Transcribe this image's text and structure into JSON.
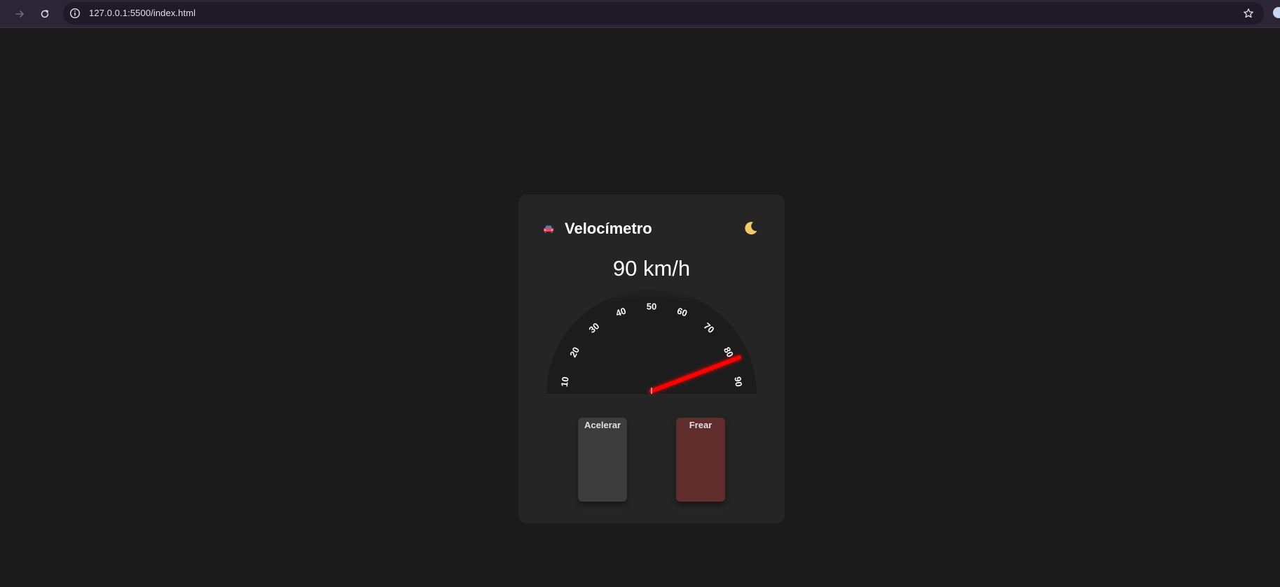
{
  "browser": {
    "url": "127.0.0.1:5500/index.html"
  },
  "app": {
    "title": "Velocímetro",
    "speed_display": "90 km/h",
    "speed_value": 90,
    "gauge": {
      "min": 0,
      "max": 90,
      "ticks": [
        "10",
        "20",
        "30",
        "40",
        "50",
        "60",
        "70",
        "80",
        "90"
      ],
      "needle_color": "#ff0000"
    },
    "accelerate_label": "Acelerar",
    "brake_label": "Frear"
  },
  "colors": {
    "page_bg": "#1b1b1b",
    "card_bg": "#252525",
    "gauge_bg": "#1c1c1c",
    "accelerate_bg": "#3c3c3c",
    "brake_bg": "#612c2c"
  },
  "icons": {
    "car": "car-icon",
    "moon": "moon-icon",
    "star": "star-icon",
    "info": "info-icon",
    "back": "arrow-back-icon",
    "reload": "reload-icon"
  }
}
